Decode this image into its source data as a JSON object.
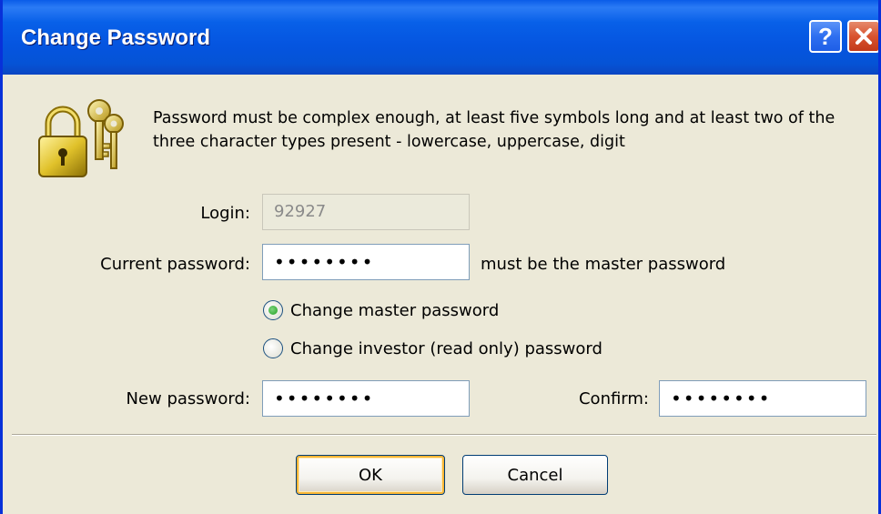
{
  "window": {
    "title": "Change Password",
    "help_glyph": "?",
    "close_icon": "close-x-icon",
    "accent": "#0054e3",
    "face": "#ece9d8"
  },
  "header": {
    "icon": "lock-with-keys-icon",
    "description": "Password must be complex enough, at least five symbols long and at least two of the three character types present - lowercase, uppercase, digit"
  },
  "form": {
    "login_label": "Login:",
    "login_value": "92927",
    "current_label": "Current password:",
    "current_value": "••••••••",
    "current_hint": "must be the master password",
    "radios": [
      {
        "label": "Change master password",
        "selected": true
      },
      {
        "label": "Change investor (read only) password",
        "selected": false
      }
    ],
    "new_label": "New password:",
    "new_value": "••••••••",
    "confirm_label": "Confirm:",
    "confirm_value": "••••••••"
  },
  "buttons": {
    "ok": "OK",
    "cancel": "Cancel"
  }
}
